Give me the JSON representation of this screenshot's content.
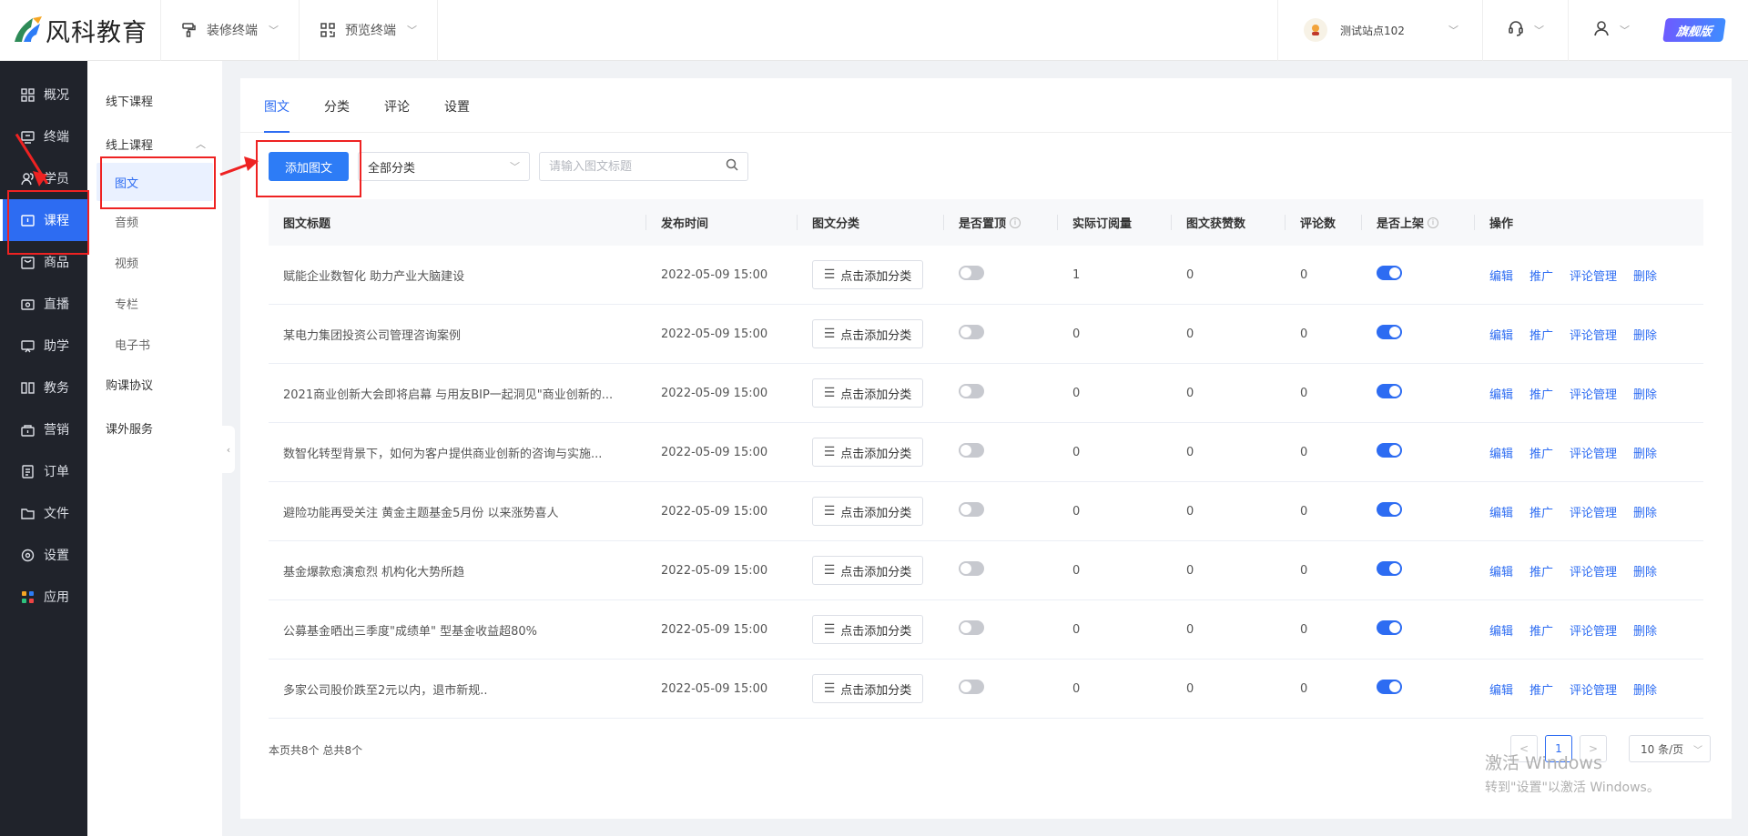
{
  "header": {
    "brand": "风科教育",
    "menus": [
      {
        "label": "装修终端",
        "icon": "paint-roller-icon"
      },
      {
        "label": "预览终端",
        "icon": "qrcode-icon"
      }
    ],
    "site_name": "测试站点102",
    "vip_label": "旗舰版"
  },
  "sidenav": [
    {
      "label": "概况",
      "icon": "grid-icon"
    },
    {
      "label": "终端",
      "icon": "terminal-icon"
    },
    {
      "label": "学员",
      "icon": "users-icon"
    },
    {
      "label": "课程",
      "icon": "course-icon"
    },
    {
      "label": "商品",
      "icon": "bag-icon"
    },
    {
      "label": "直播",
      "icon": "live-icon"
    },
    {
      "label": "助学",
      "icon": "study-icon"
    },
    {
      "label": "教务",
      "icon": "book-icon"
    },
    {
      "label": "营销",
      "icon": "marketing-icon"
    },
    {
      "label": "订单",
      "icon": "order-icon"
    },
    {
      "label": "文件",
      "icon": "folder-icon"
    },
    {
      "label": "设置",
      "icon": "settings-icon"
    },
    {
      "label": "应用",
      "icon": "apps-icon"
    }
  ],
  "subnav": {
    "offline": "线下课程",
    "online": "线上课程",
    "children": [
      "图文",
      "音频",
      "视频",
      "专栏",
      "电子书"
    ],
    "agreement": "购课协议",
    "extra": "课外服务"
  },
  "tabs": [
    "图文",
    "分类",
    "评论",
    "设置"
  ],
  "toolbar": {
    "add_label": "添加图文",
    "category_value": "全部分类",
    "search_placeholder": "请输入图文标题"
  },
  "table": {
    "headers": [
      "图文标题",
      "发布时间",
      "图文分类",
      "是否置顶",
      "实际订阅量",
      "图文获赞数",
      "评论数",
      "是否上架",
      "操作"
    ],
    "category_button": "点击添加分类",
    "actions": [
      "编辑",
      "推广",
      "评论管理",
      "删除"
    ],
    "rows": [
      {
        "title": "赋能企业数智化 助力产业大脑建设",
        "time": "2022-05-09 15:00",
        "pinned": false,
        "subs": "1",
        "likes": "0",
        "comments": "0",
        "listed": true
      },
      {
        "title": "某电力集团投资公司管理咨询案例",
        "time": "2022-05-09 15:00",
        "pinned": false,
        "subs": "0",
        "likes": "0",
        "comments": "0",
        "listed": true
      },
      {
        "title": "2021商业创新大会即将启幕 与用友BIP一起洞见\"商业创新的...",
        "time": "2022-05-09 15:00",
        "pinned": false,
        "subs": "0",
        "likes": "0",
        "comments": "0",
        "listed": true
      },
      {
        "title": "数智化转型背景下，如何为客户提供商业创新的咨询与实施...",
        "time": "2022-05-09 15:00",
        "pinned": false,
        "subs": "0",
        "likes": "0",
        "comments": "0",
        "listed": true
      },
      {
        "title": "避险功能再受关注 黄金主题基金5月份 以来涨势喜人",
        "time": "2022-05-09 15:00",
        "pinned": false,
        "subs": "0",
        "likes": "0",
        "comments": "0",
        "listed": true
      },
      {
        "title": "基金爆款愈演愈烈 机构化大势所趋",
        "time": "2022-05-09 15:00",
        "pinned": false,
        "subs": "0",
        "likes": "0",
        "comments": "0",
        "listed": true
      },
      {
        "title": "公募基金晒出三季度\"成绩单\" 型基金收益超80%",
        "time": "2022-05-09 15:00",
        "pinned": false,
        "subs": "0",
        "likes": "0",
        "comments": "0",
        "listed": true
      },
      {
        "title": "多家公司股价跌至2元以内，退市新规..",
        "time": "2022-05-09 15:00",
        "pinned": false,
        "subs": "0",
        "likes": "0",
        "comments": "0",
        "listed": true
      }
    ]
  },
  "footer": {
    "count_text": "本页共8个 总共8个",
    "prev": "<",
    "page": "1",
    "next": ">",
    "page_size": "10 条/页"
  },
  "watermark": {
    "line1": "激活 Windows",
    "line2": "转到\"设置\"以激活 Windows。"
  },
  "colors": {
    "accent": "#2d6cf2",
    "sidebar_bg": "#20232b",
    "annotation": "#ee2222"
  }
}
